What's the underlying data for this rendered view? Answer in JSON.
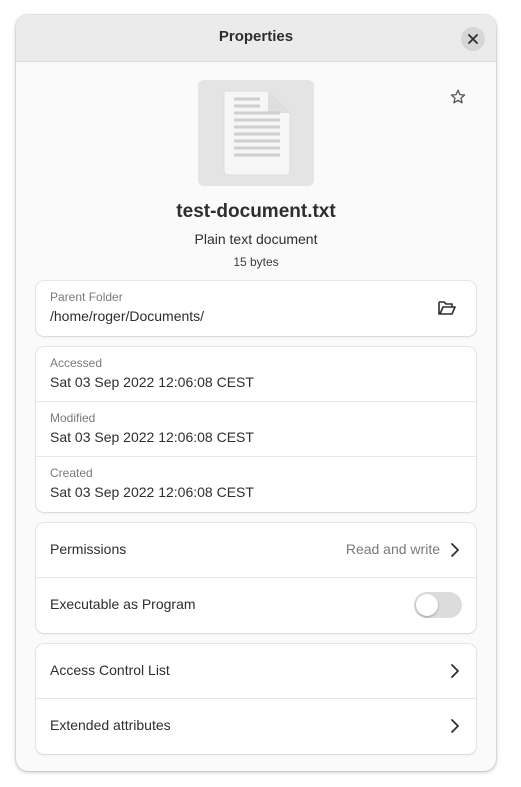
{
  "window": {
    "title": "Properties"
  },
  "icons": {
    "close": "close-icon",
    "star": "star-icon",
    "file": "text-file-icon",
    "folder": "folder-open-icon",
    "chevron": "chevron-right-icon"
  },
  "file": {
    "name": "test-document.txt",
    "type": "Plain text document",
    "size": "15 bytes"
  },
  "location": {
    "label": "Parent Folder",
    "path": "/home/roger/Documents/"
  },
  "times": [
    {
      "label": "Accessed",
      "value": "Sat 03 Sep 2022 12:06:08 CEST"
    },
    {
      "label": "Modified",
      "value": "Sat 03 Sep 2022 12:06:08 CEST"
    },
    {
      "label": "Created",
      "value": "Sat 03 Sep 2022 12:06:08 CEST"
    }
  ],
  "permissions": {
    "label": "Permissions",
    "value": "Read and write",
    "executable_label": "Executable as Program",
    "executable": false
  },
  "advanced": {
    "acl_label": "Access Control List",
    "xattr_label": "Extended attributes"
  },
  "colors": {
    "accent": "#3584e4",
    "toggle_off": "#dcdcdc",
    "header": "#ebebeb"
  }
}
